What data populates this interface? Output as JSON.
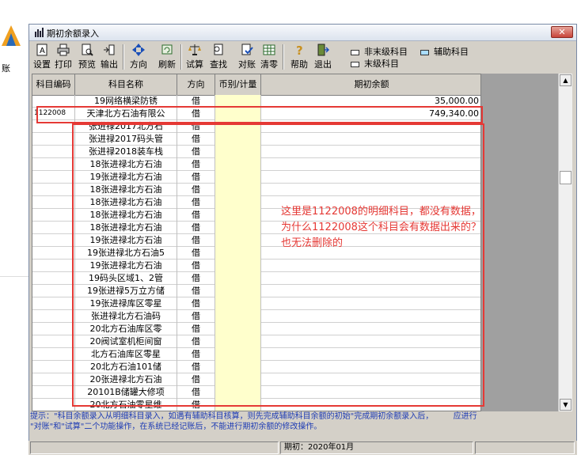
{
  "desktop": {
    "logo_label": "账"
  },
  "window": {
    "title": "期初余额录入",
    "close_label": "✕"
  },
  "toolbar": [
    {
      "name": "setup-button",
      "label": "设置",
      "icon": "setup-icon"
    },
    {
      "name": "print-button",
      "label": "打印",
      "icon": "printer-icon"
    },
    {
      "name": "preview-button",
      "label": "预览",
      "icon": "preview-icon"
    },
    {
      "name": "export-button",
      "label": "输出",
      "icon": "export-icon"
    },
    {
      "name": "direction-button",
      "label": "方向",
      "icon": "direction-icon"
    },
    {
      "name": "refresh-button",
      "label": "刷新",
      "icon": "refresh-icon"
    },
    {
      "name": "trial-balance-button",
      "label": "试算",
      "icon": "scale-icon"
    },
    {
      "name": "find-button",
      "label": "查找",
      "icon": "find-icon"
    },
    {
      "name": "reconcile-button",
      "label": "对账",
      "icon": "reconcile-icon"
    },
    {
      "name": "clear-button",
      "label": "清零",
      "icon": "clear-icon"
    },
    {
      "name": "help-button",
      "label": "帮助",
      "icon": "help-icon"
    },
    {
      "name": "exit-button",
      "label": "退出",
      "icon": "exit-icon"
    }
  ],
  "legend": [
    {
      "label": "非末级科目",
      "color": "#ffffff"
    },
    {
      "label": "辅助科目",
      "color": "#aaddff"
    },
    {
      "label": "末级科目",
      "color": "#ffffff"
    }
  ],
  "grid": {
    "columns": [
      "科目编码",
      "科目名称",
      "方向",
      "币别/计量",
      "期初余额"
    ],
    "rows": [
      {
        "code": "",
        "name": "19网络横梁防锈",
        "dir": "借",
        "amount": "35,000.00"
      },
      {
        "code": "1122008",
        "name": "天津北方石油有限公",
        "dir": "借",
        "amount": "749,340.00"
      },
      {
        "code": "",
        "name": "张进禄2017北方石",
        "dir": "借",
        "amount": ""
      },
      {
        "code": "",
        "name": "张进禄2017码头管",
        "dir": "借",
        "amount": ""
      },
      {
        "code": "",
        "name": "张进禄2018装车栈",
        "dir": "借",
        "amount": ""
      },
      {
        "code": "",
        "name": "18张进禄北方石油",
        "dir": "借",
        "amount": ""
      },
      {
        "code": "",
        "name": "19张进禄北方石油",
        "dir": "借",
        "amount": ""
      },
      {
        "code": "",
        "name": "18张进禄北方石油",
        "dir": "借",
        "amount": ""
      },
      {
        "code": "",
        "name": "18张进禄北方石油",
        "dir": "借",
        "amount": ""
      },
      {
        "code": "",
        "name": "18张进禄北方石油",
        "dir": "借",
        "amount": ""
      },
      {
        "code": "",
        "name": "18张进禄北方石油",
        "dir": "借",
        "amount": ""
      },
      {
        "code": "",
        "name": "19张进禄北方石油",
        "dir": "借",
        "amount": ""
      },
      {
        "code": "",
        "name": "19张进禄北方石油5",
        "dir": "借",
        "amount": ""
      },
      {
        "code": "",
        "name": "19张进禄北方石油",
        "dir": "借",
        "amount": ""
      },
      {
        "code": "",
        "name": "19码头区域1、2管",
        "dir": "借",
        "amount": ""
      },
      {
        "code": "",
        "name": "19张进禄5万立方储",
        "dir": "借",
        "amount": ""
      },
      {
        "code": "",
        "name": "19张进禄库区零星",
        "dir": "借",
        "amount": ""
      },
      {
        "code": "",
        "name": "张进禄北方石油码",
        "dir": "借",
        "amount": ""
      },
      {
        "code": "",
        "name": "20北方石油库区零",
        "dir": "借",
        "amount": ""
      },
      {
        "code": "",
        "name": "20阀试室机柜间窗",
        "dir": "借",
        "amount": ""
      },
      {
        "code": "",
        "name": "北方石油库区零星",
        "dir": "借",
        "amount": ""
      },
      {
        "code": "",
        "name": "20北方石油101储",
        "dir": "借",
        "amount": ""
      },
      {
        "code": "",
        "name": "20张进禄北方石油",
        "dir": "借",
        "amount": ""
      },
      {
        "code": "",
        "name": "20101B储罐大修项",
        "dir": "借",
        "amount": ""
      },
      {
        "code": "",
        "name": "20北方石油零星维",
        "dir": "借",
        "amount": ""
      }
    ]
  },
  "annotation": {
    "text": "这里是1122008的明细科目，都没有数据，为什么1122008这个科目会有数据出来的？也无法删除的",
    "color": "#e53935"
  },
  "hint": {
    "line1": "提示：\"科目余额录入从明细科目录入，如遇有辅助科目核算，则先完成辅助科目余额的初始\"完成期初余额录入后，        应进行",
    "line2": "\"对账\"和\"试算\"二个功能操作，在系统已经记账后，不能进行期初余额的修改操作。"
  },
  "status": {
    "period": "期初：2020年01月"
  }
}
